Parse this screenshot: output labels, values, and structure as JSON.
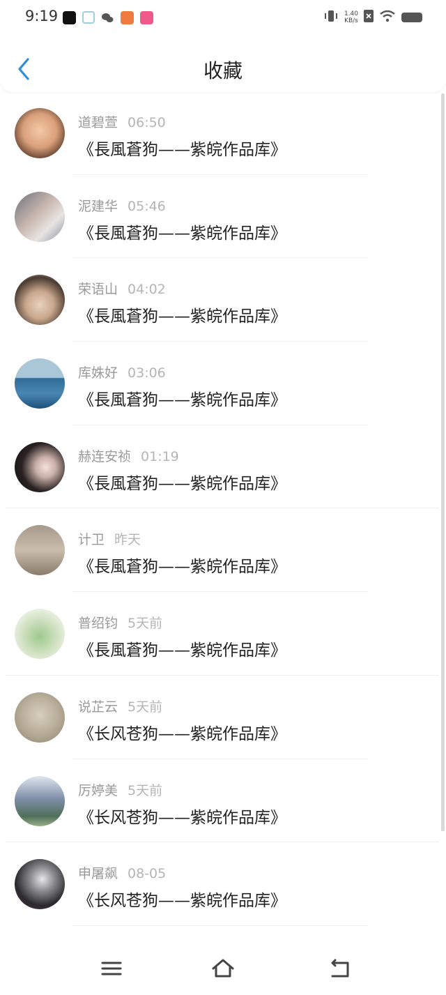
{
  "status": {
    "time": "9:19",
    "speed_value": "1.40",
    "speed_unit": "KB/s"
  },
  "header": {
    "title": "收藏"
  },
  "items": [
    {
      "name": "道碧萱",
      "time": "06:50",
      "title": "《長風蒼狗——紫皖作品库》"
    },
    {
      "name": "泥建华",
      "time": "05:46",
      "title": "《長風蒼狗——紫皖作品库》"
    },
    {
      "name": "荣语山",
      "time": "04:02",
      "title": "《長風蒼狗——紫皖作品库》"
    },
    {
      "name": "库姝好",
      "time": "03:06",
      "title": "《長風蒼狗——紫皖作品库》"
    },
    {
      "name": "赫连安祯",
      "time": "01:19",
      "title": "《長風蒼狗——紫皖作品库》"
    },
    {
      "name": "计卫",
      "time": "昨天",
      "title": "《長風蒼狗——紫皖作品库》"
    },
    {
      "name": "普绍钧",
      "time": "5天前",
      "title": "《長風蒼狗——紫皖作品库》"
    },
    {
      "name": "说芷云",
      "time": "5天前",
      "title": "《长风苍狗——紫皖作品库》"
    },
    {
      "name": "厉婷美",
      "time": "5天前",
      "title": "《长风苍狗——紫皖作品库》"
    },
    {
      "name": "申屠飙",
      "time": "08-05",
      "title": "《长风苍狗——紫皖作品库》"
    }
  ],
  "avatar_colors": [
    "#d9a07a",
    "#8a8f99",
    "#6b5a4e",
    "#3d6f95",
    "#3a3030",
    "#b8a590",
    "#cfe0c0",
    "#b7ad98",
    "#7f8ea8",
    "#2a2a2e"
  ]
}
